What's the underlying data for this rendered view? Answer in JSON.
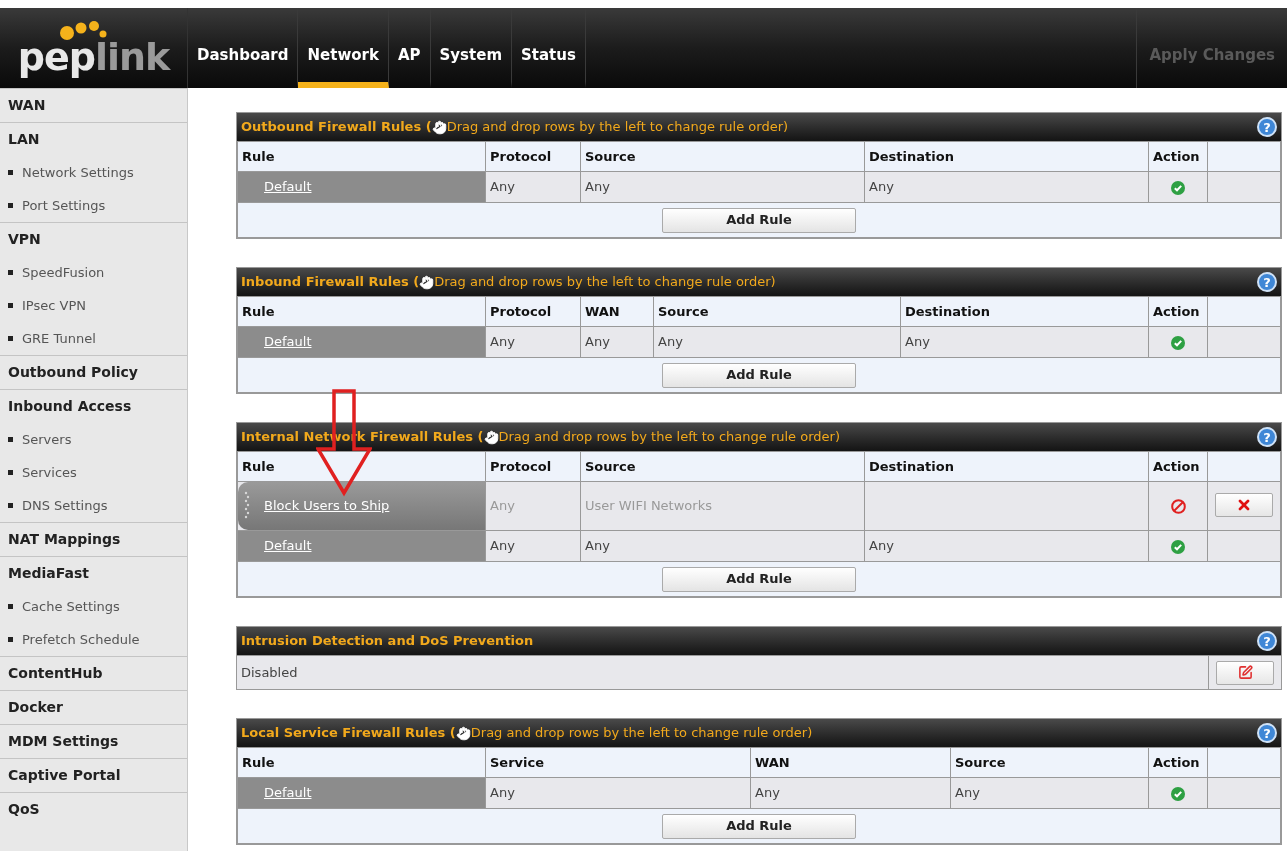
{
  "logo": [
    "pep",
    "link"
  ],
  "nav": [
    {
      "label": "Dashboard",
      "selected": false
    },
    {
      "label": "Network",
      "selected": true
    },
    {
      "label": "AP",
      "selected": false
    },
    {
      "label": "System",
      "selected": false
    },
    {
      "label": "Status",
      "selected": false
    }
  ],
  "apply_button": {
    "label": "Apply Changes",
    "disabled": true
  },
  "sidebar": [
    {
      "kind": "header",
      "label": "WAN"
    },
    {
      "kind": "header",
      "label": "LAN"
    },
    {
      "kind": "sub",
      "label": "Network Settings"
    },
    {
      "kind": "sub",
      "label": "Port Settings"
    },
    {
      "kind": "header",
      "label": "VPN"
    },
    {
      "kind": "sub",
      "label": "SpeedFusion"
    },
    {
      "kind": "sub",
      "label": "IPsec VPN"
    },
    {
      "kind": "sub",
      "label": "GRE Tunnel"
    },
    {
      "kind": "header",
      "label": "Outbound Policy"
    },
    {
      "kind": "header",
      "label": "Inbound Access"
    },
    {
      "kind": "sub",
      "label": "Servers"
    },
    {
      "kind": "sub",
      "label": "Services"
    },
    {
      "kind": "sub",
      "label": "DNS Settings"
    },
    {
      "kind": "header",
      "label": "NAT Mappings"
    },
    {
      "kind": "header",
      "label": "MediaFast"
    },
    {
      "kind": "sub",
      "label": "Cache Settings"
    },
    {
      "kind": "sub",
      "label": "Prefetch Schedule"
    },
    {
      "kind": "header",
      "label": "ContentHub"
    },
    {
      "kind": "header",
      "label": "Docker"
    },
    {
      "kind": "header",
      "label": "MDM Settings"
    },
    {
      "kind": "header",
      "label": "Captive Portal"
    },
    {
      "kind": "header",
      "label": "QoS"
    }
  ],
  "sections": [
    {
      "kind": "rules",
      "title": "Outbound Firewall Rules (",
      "hint": "Drag and drop rows by the left to change rule order)",
      "help": "?",
      "columns": [
        "Rule",
        "Protocol",
        "Source",
        "Destination",
        "Action"
      ],
      "rows": [
        {
          "cells": [
            "Default",
            "Any",
            "Any",
            "Any"
          ],
          "kind": "allow",
          "disabled": false,
          "draggable": false,
          "deletable": false
        }
      ],
      "add_button": "Add Rule"
    },
    {
      "kind": "rules",
      "title": "Inbound Firewall Rules (",
      "hint": "Drag and drop rows by the left to change rule order)",
      "help": "?",
      "columns": [
        "Rule",
        "Protocol",
        "WAN",
        "Source",
        "Destination",
        "Action"
      ],
      "rows": [
        {
          "cells": [
            "Default",
            "Any",
            "Any",
            "Any",
            "Any"
          ],
          "kind": "allow",
          "disabled": false,
          "draggable": false,
          "deletable": false
        }
      ],
      "add_button": "Add Rule"
    },
    {
      "kind": "rules",
      "title": "Internal Network Firewall Rules (",
      "hint": "Drag and drop rows by the left to change rule order)",
      "help": "?",
      "columns": [
        "Rule",
        "Protocol",
        "Source",
        "Destination",
        "Action"
      ],
      "rows": [
        {
          "cells": [
            "Block Users to Ship",
            "Any",
            "User WIFI Networks",
            ""
          ],
          "kind": "deny",
          "disabled": true,
          "draggable": true,
          "deletable": true
        },
        {
          "cells": [
            "Default",
            "Any",
            "Any",
            "Any"
          ],
          "kind": "allow",
          "disabled": false,
          "draggable": false,
          "deletable": false
        }
      ],
      "add_button": "Add Rule"
    },
    {
      "kind": "status",
      "title": "Intrusion Detection and DoS Prevention",
      "help": "?",
      "value": "Disabled"
    },
    {
      "kind": "rules",
      "title": "Local Service Firewall Rules (",
      "hint": "Drag and drop rows by the left to change rule order)",
      "help": "?",
      "columns": [
        "Rule",
        "Service",
        "WAN",
        "Source",
        "Action"
      ],
      "rows": [
        {
          "cells": [
            "Default",
            "Any",
            "Any",
            "Any"
          ],
          "kind": "allow",
          "disabled": false,
          "draggable": false,
          "deletable": false
        }
      ],
      "add_button": "Add Rule"
    }
  ]
}
